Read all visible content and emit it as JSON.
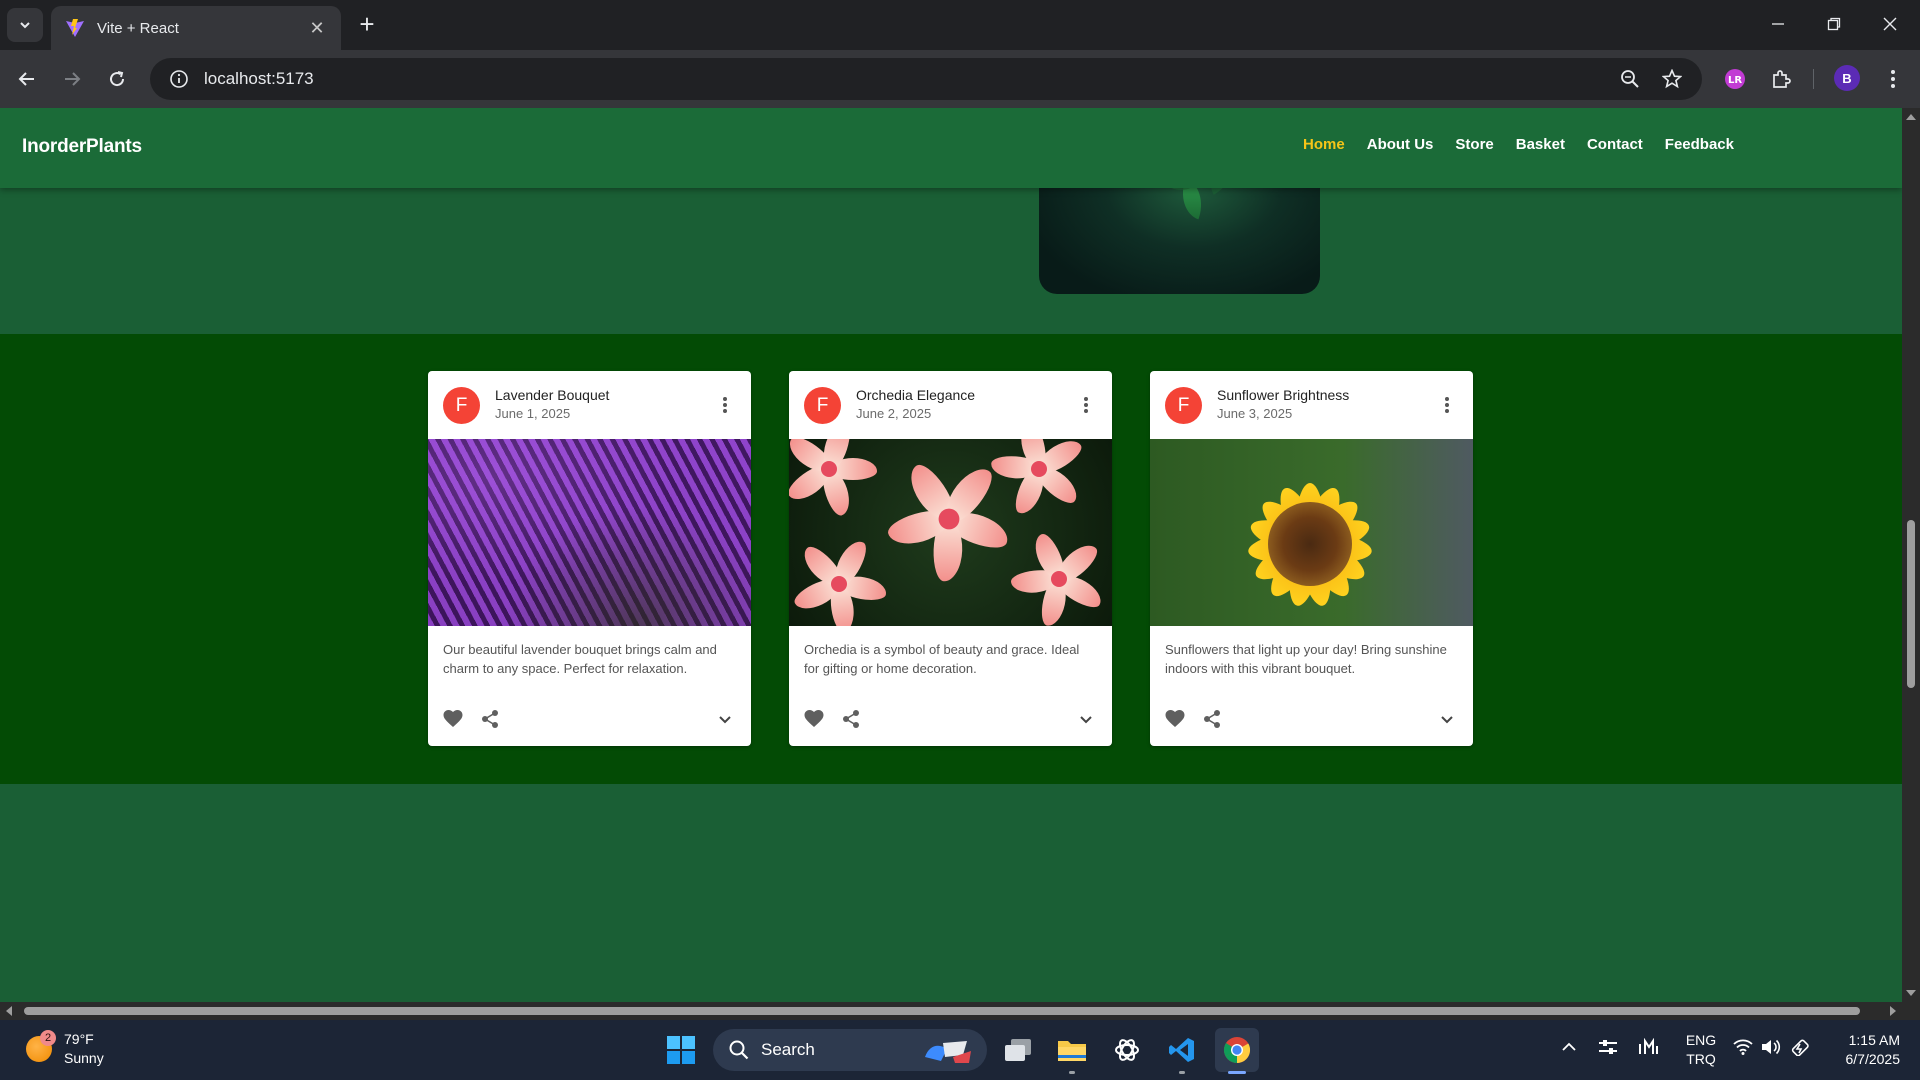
{
  "browser": {
    "tab_title": "Vite + React",
    "url": "localhost:5173",
    "profile_initial": "B"
  },
  "site": {
    "brand": "InorderPlants",
    "nav": [
      {
        "label": "Home",
        "active": true
      },
      {
        "label": "About Us",
        "active": false
      },
      {
        "label": "Store",
        "active": false
      },
      {
        "label": "Basket",
        "active": false
      },
      {
        "label": "Contact",
        "active": false
      },
      {
        "label": "Feedback",
        "active": false
      }
    ],
    "active_color": "#f5c518"
  },
  "cards": [
    {
      "avatar": "F",
      "title": "Lavender Bouquet",
      "date": "June 1, 2025",
      "description": "Our beautiful lavender bouquet brings calm and charm to any space. Perfect for relaxation.",
      "image": "lavender-field"
    },
    {
      "avatar": "F",
      "title": "Orchedia Elegance",
      "date": "June 2, 2025",
      "description": "Orchedia is a symbol of beauty and grace. Ideal for gifting or home decoration.",
      "image": "pink-plumeria-flowers"
    },
    {
      "avatar": "F",
      "title": "Sunflower Brightness",
      "date": "June 3, 2025",
      "description": "Sunflowers that light up your day! Bring sunshine indoors with this vibrant bouquet.",
      "image": "sunflower"
    }
  ],
  "taskbar": {
    "weather_badge": "2",
    "temperature": "79°F",
    "condition": "Sunny",
    "search_label": "Search",
    "lang_top": "ENG",
    "lang_bottom": "TRQ",
    "time": "1:15 AM",
    "date": "6/7/2025"
  },
  "colors": {
    "navbar": "#1b6b38",
    "page_bg": "#1a5f35",
    "cards_section_bg": "#034b05",
    "avatar": "#f44336"
  }
}
